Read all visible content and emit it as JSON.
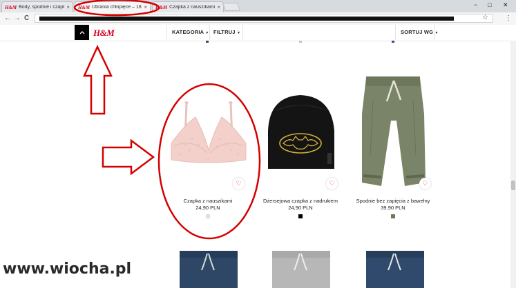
{
  "browser": {
    "tabs": [
      {
        "favicon": "H&M",
        "label": "Body, spodnie i czapka -",
        "active": false
      },
      {
        "favicon": "H&M",
        "label": "Ubrania chłopięce – 18 m",
        "active": true
      },
      {
        "favicon": "H&M",
        "label": "Czapka z nauszikami - I",
        "active": false
      }
    ],
    "window_controls": [
      "−",
      "□",
      "✕"
    ],
    "nav": {
      "back": "←",
      "forward": "→",
      "reload": "C"
    },
    "star_icon": "☆",
    "menu_icon": "⋮"
  },
  "header": {
    "logo": "H&M",
    "up_icon": "chevron-up-icon",
    "category_label": "KATEGORIA",
    "filter_label": "FILTRUJ",
    "sort_label": "SORTUJ WG"
  },
  "products": [
    {
      "name": "Czapka z nauszikami",
      "price": "24,90 PLN",
      "swatch_color": "#f4d9d4",
      "image": "pink-lace-bra"
    },
    {
      "name": "Dżersejowa czapka z nadrukiem",
      "price": "24,90 PLN",
      "swatch_color": "#000000",
      "image": "black-batman-beanie"
    },
    {
      "name": "Spodnie bez zapięcia z bawełny",
      "price": "39,90 PLN",
      "swatch_color": "#6b7a5a",
      "image": "khaki-jogger-pants"
    }
  ],
  "watermark": "www.wiocha.pl",
  "colors": {
    "brand_red": "#d6001c",
    "annotation_red": "#d40000"
  }
}
